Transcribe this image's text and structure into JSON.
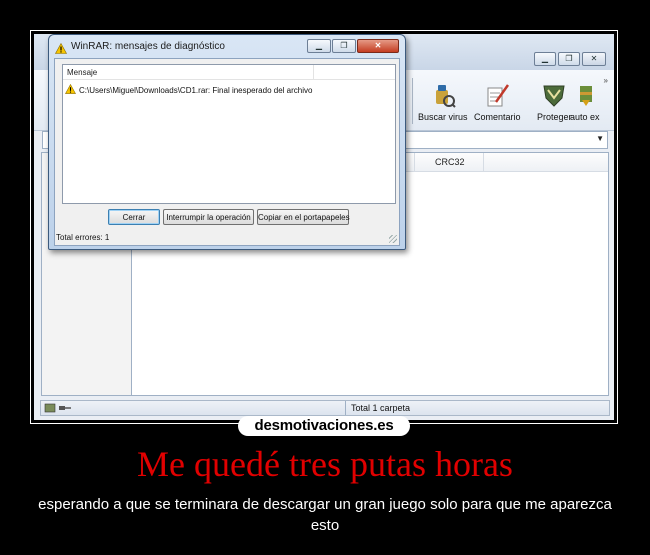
{
  "dialog": {
    "title": "WinRAR: mensajes de diagnóstico",
    "column_header": "Mensaje",
    "message": "C:\\Users\\Miguel\\Downloads\\CD1.rar: Final inesperado del archivo",
    "buttons": {
      "close": "Cerrar",
      "interrupt": "Interrumpir la operación",
      "copy": "Copiar en el portapapeles"
    },
    "total_errors": "Total errores: 1"
  },
  "toolbar": {
    "items": [
      {
        "label": "Buscar virus",
        "icon": "virus-scan-icon"
      },
      {
        "label": "Comentario",
        "icon": "comment-icon"
      },
      {
        "label": "Proteger",
        "icon": "shield-icon"
      },
      {
        "label": "auto ex",
        "icon": "sfx-icon"
      }
    ]
  },
  "file_list": {
    "columns": [
      "CRC32"
    ]
  },
  "statusbar": {
    "text": "Total 1 carpeta"
  },
  "poster": {
    "site": "desmotivaciones.es",
    "headline": "Me quedé tres putas horas",
    "caption": "esperando a que se terminara de descargar un gran juego solo para que me aparezca esto",
    "headline_color": "#e10000"
  }
}
